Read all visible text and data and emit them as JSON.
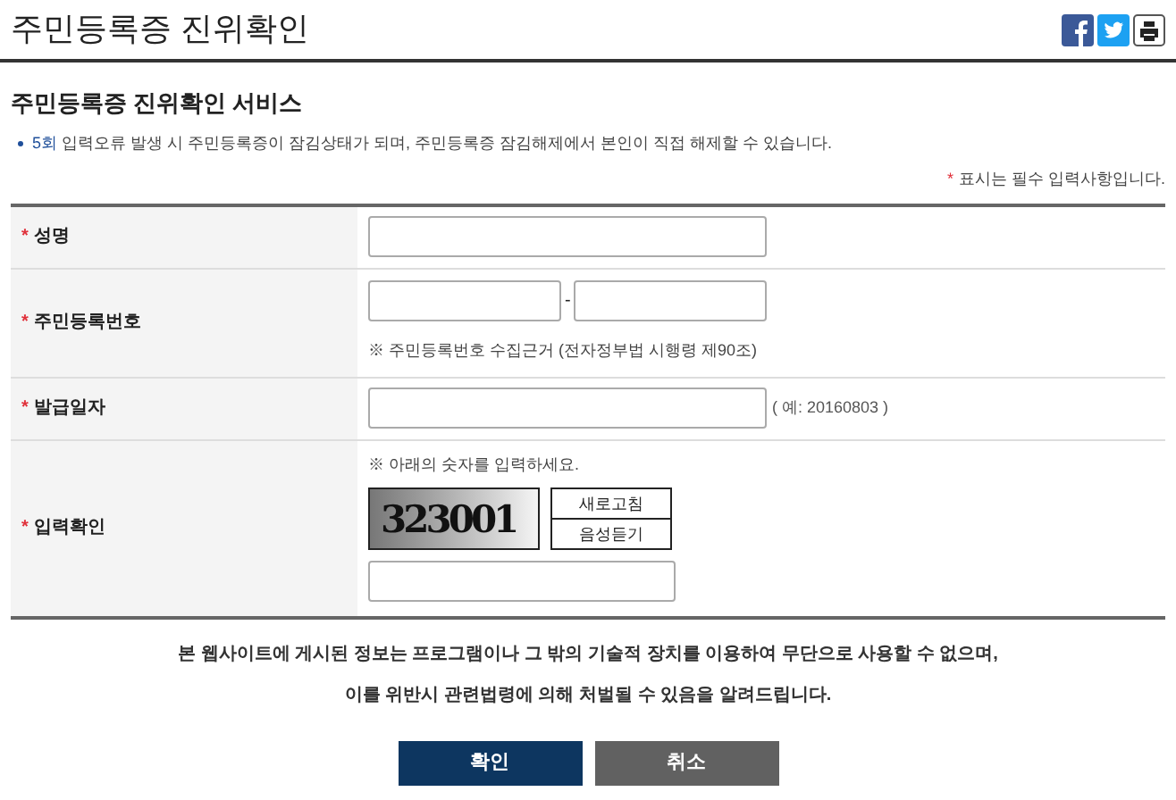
{
  "header": {
    "title": "주민등록증 진위확인"
  },
  "section_title": "주민등록증 진위확인 서비스",
  "notice": {
    "highlight": "5회",
    "text": "입력오류 발생 시 주민등록증이 잠김상태가 되며, 주민등록증 잠김해제에서 본인이 직접 해제할 수 있습니다."
  },
  "required_note": {
    "mark": "*",
    "text": "표시는 필수 입력사항입니다."
  },
  "rows": [
    {
      "kind": "text",
      "label": "성명",
      "required": true
    },
    {
      "kind": "split",
      "label": "주민등록번호",
      "required": true,
      "separator": "-",
      "note": "※ 주민등록번호 수집근거 (전자정부법 시행령 제90조)"
    },
    {
      "kind": "text",
      "label": "발급일자",
      "required": true,
      "hint": "( 예: 20160803 )"
    },
    {
      "kind": "captcha",
      "label": "입력확인",
      "required": true,
      "note": "※ 아래의 숫자를 입력하세요.",
      "code": "323001",
      "buttons": [
        "새로고침",
        "음성듣기"
      ]
    }
  ],
  "disclaimer": [
    "본 웹사이트에 게시된 정보는 프로그램이나 그 밖의 기술적 장치를 이용하여 무단으로 사용할 수 없으며,",
    "이를 위반시 관련법령에 의해 처벌될 수 있음을 알려드립니다."
  ],
  "buttons": [
    {
      "label": "확인",
      "kind": "primary"
    },
    {
      "label": "취소",
      "kind": "secondary"
    }
  ]
}
